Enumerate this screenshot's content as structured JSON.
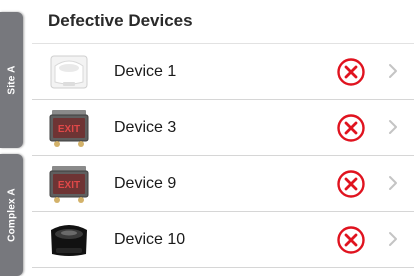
{
  "tabs": [
    {
      "label": "Site A"
    },
    {
      "label": "Complex A"
    }
  ],
  "header": {
    "title": "Defective Devices"
  },
  "devices": [
    {
      "name": "Device 1",
      "thumbnail": "white-fixture",
      "status": "error",
      "status_icon": "error-x-circle-icon"
    },
    {
      "name": "Device 3",
      "thumbnail": "exit-sign-fixture",
      "status": "error",
      "status_icon": "error-x-circle-icon"
    },
    {
      "name": "Device 9",
      "thumbnail": "exit-sign-fixture",
      "status": "error",
      "status_icon": "error-x-circle-icon"
    },
    {
      "name": "Device 10",
      "thumbnail": "black-fixture",
      "status": "error",
      "status_icon": "error-x-circle-icon"
    }
  ],
  "colors": {
    "tab_background": "#77787d",
    "error": "#e0131f",
    "chevron": "#c4c4c4"
  }
}
